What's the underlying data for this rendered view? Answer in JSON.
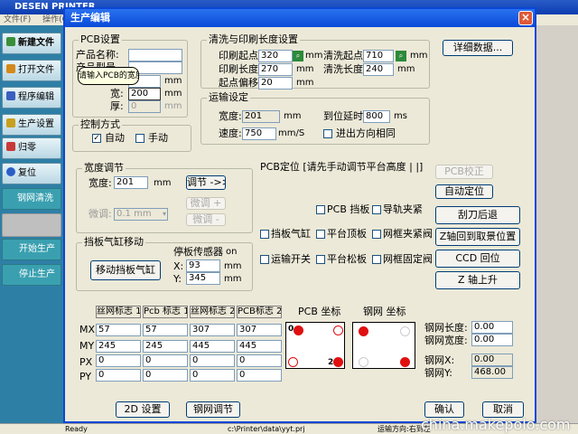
{
  "app": {
    "title": "DESEN PRINTER",
    "menu": [
      "文件(F)",
      "操作(O)"
    ],
    "nav": [
      "新建文件",
      "打开文件",
      "程序编辑",
      "生产设置",
      "归零",
      "复位",
      "钢网清洗",
      "开始生产",
      "停止生产"
    ],
    "status": {
      "ready": "Ready",
      "path": "c:\\Printer\\data\\yyt.prj",
      "direction": "运输方向:右到左"
    }
  },
  "dialog": {
    "title": "生产编辑",
    "close": "×",
    "detail_button": "详细数据...",
    "pcb_settings": {
      "title": "PCB设置",
      "name_label": "产品名称:",
      "name_value": "",
      "type_label": "产品型号",
      "length_value": "",
      "width_label": "宽:",
      "width_value": "200",
      "thick_label": "厚:",
      "thick_value": "0",
      "unit": "mm",
      "tooltip": "请输入PCB的宽度"
    },
    "print_length": {
      "title": "清洗与印刷长度设置",
      "print_start_label": "印刷起点:",
      "print_start_value": "320",
      "print_len_label": "印刷长度:",
      "print_len_value": "270",
      "offset_label": "起点偏移:",
      "offset_value": "20",
      "clean_start_label": "清洗起点:",
      "clean_start_value": "710",
      "clean_len_label": "清洗长度:",
      "clean_len_value": "240",
      "unit": "mm"
    },
    "transport": {
      "title": "运输设定",
      "width_label": "宽度:",
      "width_value": "201",
      "width_unit": "mm",
      "delay_label": "到位延时:",
      "delay_value": "800",
      "delay_unit": "ms",
      "speed_label": "速度:",
      "speed_value": "750",
      "speed_unit": "mm/S",
      "same_dir_label": "进出方向相同"
    },
    "control": {
      "title": "控制方式",
      "auto_label": "自动",
      "manual_label": "手动"
    },
    "width_adjust": {
      "title": "宽度调节",
      "width_label": "宽度:",
      "width_value": "201",
      "unit": "mm",
      "adjust_button": "调节 ->>",
      "fine_label": "微调:",
      "fine_value": "0.1 mm",
      "fine_plus": "微调 +",
      "fine_minus": "微调 -"
    },
    "cylinder": {
      "title": "挡板气缸移动",
      "move_button": "移动挡板气缸",
      "sensor_label": "停板传感器",
      "sensor_state": "on",
      "x_label": "X:",
      "x_value": "93",
      "y_label": "Y:",
      "y_value": "345",
      "unit": "mm"
    },
    "pcb_position": {
      "title": "PCB定位 [请先手动调节平台高度 | |]",
      "pcb_stopper": "PCB 挡板",
      "rail_clamp": "导轨夹紧",
      "platform_top": "平台顶板",
      "frame_clamp": "网框夹紧阀",
      "stop_cylinder": "挡板气缸",
      "platform_loosen": "平台松板",
      "frame_fix": "网框固定阀",
      "transport_switch": "运输开关"
    },
    "right_buttons": [
      "PCB校正",
      "自动定位",
      "刮刀后退",
      "Z轴回到取景位置",
      "CCD 回位",
      "Z 轴上升"
    ],
    "marks": {
      "headers": [
        "丝网标志 1",
        "Pcb 标志 1",
        "丝网标志 2",
        "PCB标志 2"
      ],
      "rows": [
        {
          "label": "MX",
          "values": [
            "57",
            "57",
            "307",
            "307"
          ]
        },
        {
          "label": "MY",
          "values": [
            "245",
            "245",
            "445",
            "445"
          ]
        },
        {
          "label": "PX",
          "values": [
            "0",
            "0",
            "0",
            "0"
          ]
        },
        {
          "label": "PY",
          "values": [
            "0",
            "0",
            "0",
            "0"
          ]
        }
      ],
      "pcb_coord_label": "PCB 坐标",
      "stencil_coord_label": "钢网 坐标",
      "mark_0": "0",
      "mark_2": "2"
    },
    "stencil": {
      "len_label": "钢网长度:",
      "len_value": "0.00",
      "width_label": "钢网宽度:",
      "width_value": "0.00",
      "x_label": "钢网X:",
      "x_value": "0.00",
      "y_label": "钢网Y:",
      "y_value": "468.00"
    },
    "bottom_buttons": {
      "setup_2d": "2D 设置",
      "stencil_adjust": "钢网调节",
      "ok": "确认",
      "cancel": "取消"
    }
  },
  "watermark": "china.makepolo.com",
  "colors": {
    "title_blue": "#0a4ad8",
    "nav_teal": "#2e7fa6",
    "mark_red": "#e01010"
  }
}
